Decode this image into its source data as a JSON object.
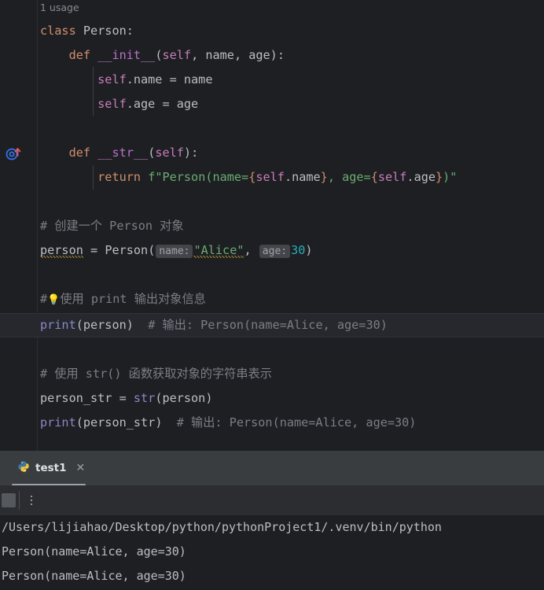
{
  "theme": {
    "editor_bg": "#1e1f22",
    "current_line_bg": "#26282e",
    "panel_header_bg": "#3a3d40",
    "toolbar_bg": "#2b2d30",
    "keyword": "#cf8e6d",
    "string": "#6aab73",
    "number": "#2aacb8",
    "comment": "#7a7e85",
    "self_keyword": "#c77dbb",
    "magic_method": "#b872c9",
    "builtin_function": "#8888c6",
    "default_text": "#bcbec4",
    "typo_squiggle": "#9c8334"
  },
  "editor": {
    "gutter": {
      "icon_name": "overriding-method-icon",
      "icon_colors": {
        "circle": "#3574f0",
        "arrow": "#e55765"
      }
    },
    "inlay_usage_hint": "1 usage",
    "lines": [
      {
        "type": "usage",
        "text": "1 usage"
      },
      {
        "type": "code",
        "text": "class Person:"
      },
      {
        "type": "code",
        "text": "    def __init__(self, name, age):"
      },
      {
        "type": "code",
        "text": "        self.name = name"
      },
      {
        "type": "code",
        "text": "        self.age = age"
      },
      {
        "type": "code",
        "text": ""
      },
      {
        "type": "code",
        "text": "    def __str__(self):"
      },
      {
        "type": "code",
        "text": "        return f\"Person(name={self.name}, age={self.age})\""
      },
      {
        "type": "code",
        "text": ""
      },
      {
        "type": "code",
        "text": "# 创建一个 Person 对象"
      },
      {
        "type": "code",
        "text": "person = Person(\"Alice\", 30)"
      },
      {
        "type": "code",
        "text": ""
      },
      {
        "type": "code",
        "text": "#💡使用 print 输出对象信息"
      },
      {
        "type": "code",
        "text": "print(person)  # 输出: Person(name=Alice, age=30)",
        "current": true
      },
      {
        "type": "code",
        "text": ""
      },
      {
        "type": "code",
        "text": "# 使用 str() 函数获取对象的字符串表示"
      },
      {
        "type": "code",
        "text": "person_str = str(person)"
      },
      {
        "type": "code",
        "text": "print(person_str)  # 输出: Person(name=Alice, age=30)"
      }
    ],
    "tokens": {
      "kw_class": "class",
      "kw_def": "def",
      "kw_return": "return",
      "cls_person": "Person",
      "magic_init": "__init__",
      "magic_str": "__str__",
      "self": "self",
      "name_param": "name",
      "age_param": "age",
      "dot_name": ".name",
      "dot_age": ".age",
      "colon": ":",
      "open_paren": "(",
      "close_paren": ")",
      "comma_sp": ", ",
      "eq": " = ",
      "fstring_head": "f\"Person(name=",
      "fstring_mid": ", age=",
      "fstring_tail": ")\"",
      "lbrace": "{",
      "rbrace": "}",
      "comment_create": "# 创建一个 Person 对象",
      "var_person": "person",
      "hint_name": "name:",
      "hint_age": "age:",
      "str_alice": "\"Alice\"",
      "num_30": "30",
      "comment_hash": "#",
      "bulb": "💡",
      "comment_print_cn": "使用 print 输出对象信息",
      "fn_print": "print",
      "comment_output": "  # 输出: Person(name=Alice, age=30)",
      "comment_str_cn": "# 使用 str() 函数获取对象的字符串表示",
      "var_person_str": "person_str",
      "fn_str": "str",
      "indent4": "    ",
      "indent8": "        "
    }
  },
  "run_panel": {
    "tab": {
      "label": "test1",
      "icon_name": "python-logo-icon",
      "close_label": "✕",
      "active": true
    },
    "toolbar": {
      "stop_button_name": "stop-button",
      "more_button_name": "more-options-button"
    },
    "console_lines": [
      "/Users/lijiahao/Desktop/python/pythonProject1/.venv/bin/python",
      "Person(name=Alice, age=30)",
      "Person(name=Alice, age=30)"
    ]
  }
}
